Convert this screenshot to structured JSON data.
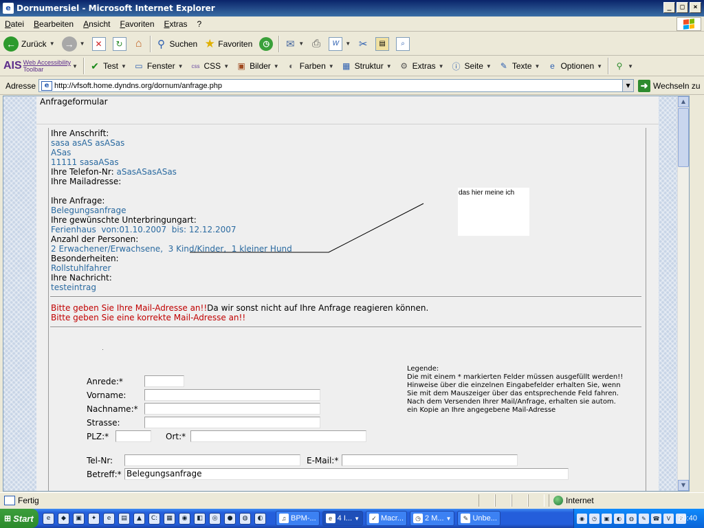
{
  "window": {
    "title": "Dornumersiel - Microsoft Internet Explorer"
  },
  "menu": [
    "Datei",
    "Bearbeiten",
    "Ansicht",
    "Favoriten",
    "Extras",
    "?"
  ],
  "toolbar": {
    "back": "Zurück",
    "search": "Suchen",
    "favorites": "Favoriten"
  },
  "ais_toolbar": {
    "logo": "AIS",
    "brand_line1": "Web Accessibility",
    "brand_line2": "Toolbar",
    "items": [
      "Test",
      "Fenster",
      "CSS",
      "Bilder",
      "Farben",
      "Struktur",
      "Extras",
      "Seite",
      "Texte",
      "Optionen"
    ]
  },
  "address": {
    "label": "Adresse",
    "url": "http://vfsoft.home.dyndns.org/dornum/anfrage.php",
    "go": "Wechseln zu"
  },
  "page": {
    "title": "Anfrageformular",
    "summary": {
      "address_label": "Ihre Anschrift:",
      "address_line1": "sasa asAS asASas",
      "address_line2": "ASas",
      "address_line3": "11111 sasaASas",
      "phone_label": "Ihre Telefon-Nr:",
      "phone_value": "aSasASasASas",
      "mail_label": "Ihre Mailadresse:",
      "request_label": "Ihre Anfrage:",
      "request_value": "Belegungsanfrage",
      "accommodation_label": "Ihre gewünschte Unterbringungart:",
      "accommodation_value": "Ferienhaus  von:01.10.2007  bis: 12.12.2007",
      "persons_label": "Anzahl der Personen:",
      "persons_value": "2 Erwachener/Erwachsene,  3 Kind/Kinder,  1 kleiner Hund",
      "special_label": "Besonderheiten:",
      "special_value": "Rollstuhlfahrer",
      "message_label": "Ihre Nachricht:",
      "message_value": "testeintrag"
    },
    "errors": {
      "line1_red": "Bitte geben Sie Ihre Mail-Adresse an!!",
      "line1_black": "Da wir sonst nicht auf Ihre Anfrage reagieren können.",
      "line2": "Bitte geben Sie eine korrekte Mail-Adresse an!!"
    },
    "annotation": "das hier meine ich",
    "legend": {
      "title": "Legende:",
      "text1": "Die mit einem * markierten Felder müssen ausgefüllt werden!!",
      "text2": "Hinweise über die einzelnen Eingabefelder erhalten Sie, wenn Sie mit dem Mauszeiger über das entsprechende Feld fahren.",
      "text3": "Nach dem Versenden Ihrer Mail/Anfrage, erhalten sie autom. ein Kopie an Ihre angegebene Mail-Adresse"
    },
    "form": {
      "anrede_label": "Anrede:*",
      "anrede_value": "",
      "vorname_label": "Vorname:",
      "vorname_value": "",
      "nachname_label": "Nachname:*",
      "nachname_value": "",
      "strasse_label": "Strasse:",
      "strasse_value": "",
      "plz_label": "PLZ:*",
      "plz_value": "",
      "ort_label": "Ort:*",
      "ort_value": "",
      "tel_label": "Tel-Nr:",
      "tel_value": "",
      "email_label": "E-Mail:*",
      "email_value": "",
      "betreff_label": "Betreff:*",
      "betreff_value": "Belegungsanfrage"
    }
  },
  "status": {
    "text": "Fertig",
    "zone": "Internet"
  },
  "taskbar": {
    "start": "Start",
    "tasks": [
      "BPM-...",
      "4 I...",
      "Macr...",
      "2 M...",
      "Unbe..."
    ],
    "clock": "20:40"
  }
}
